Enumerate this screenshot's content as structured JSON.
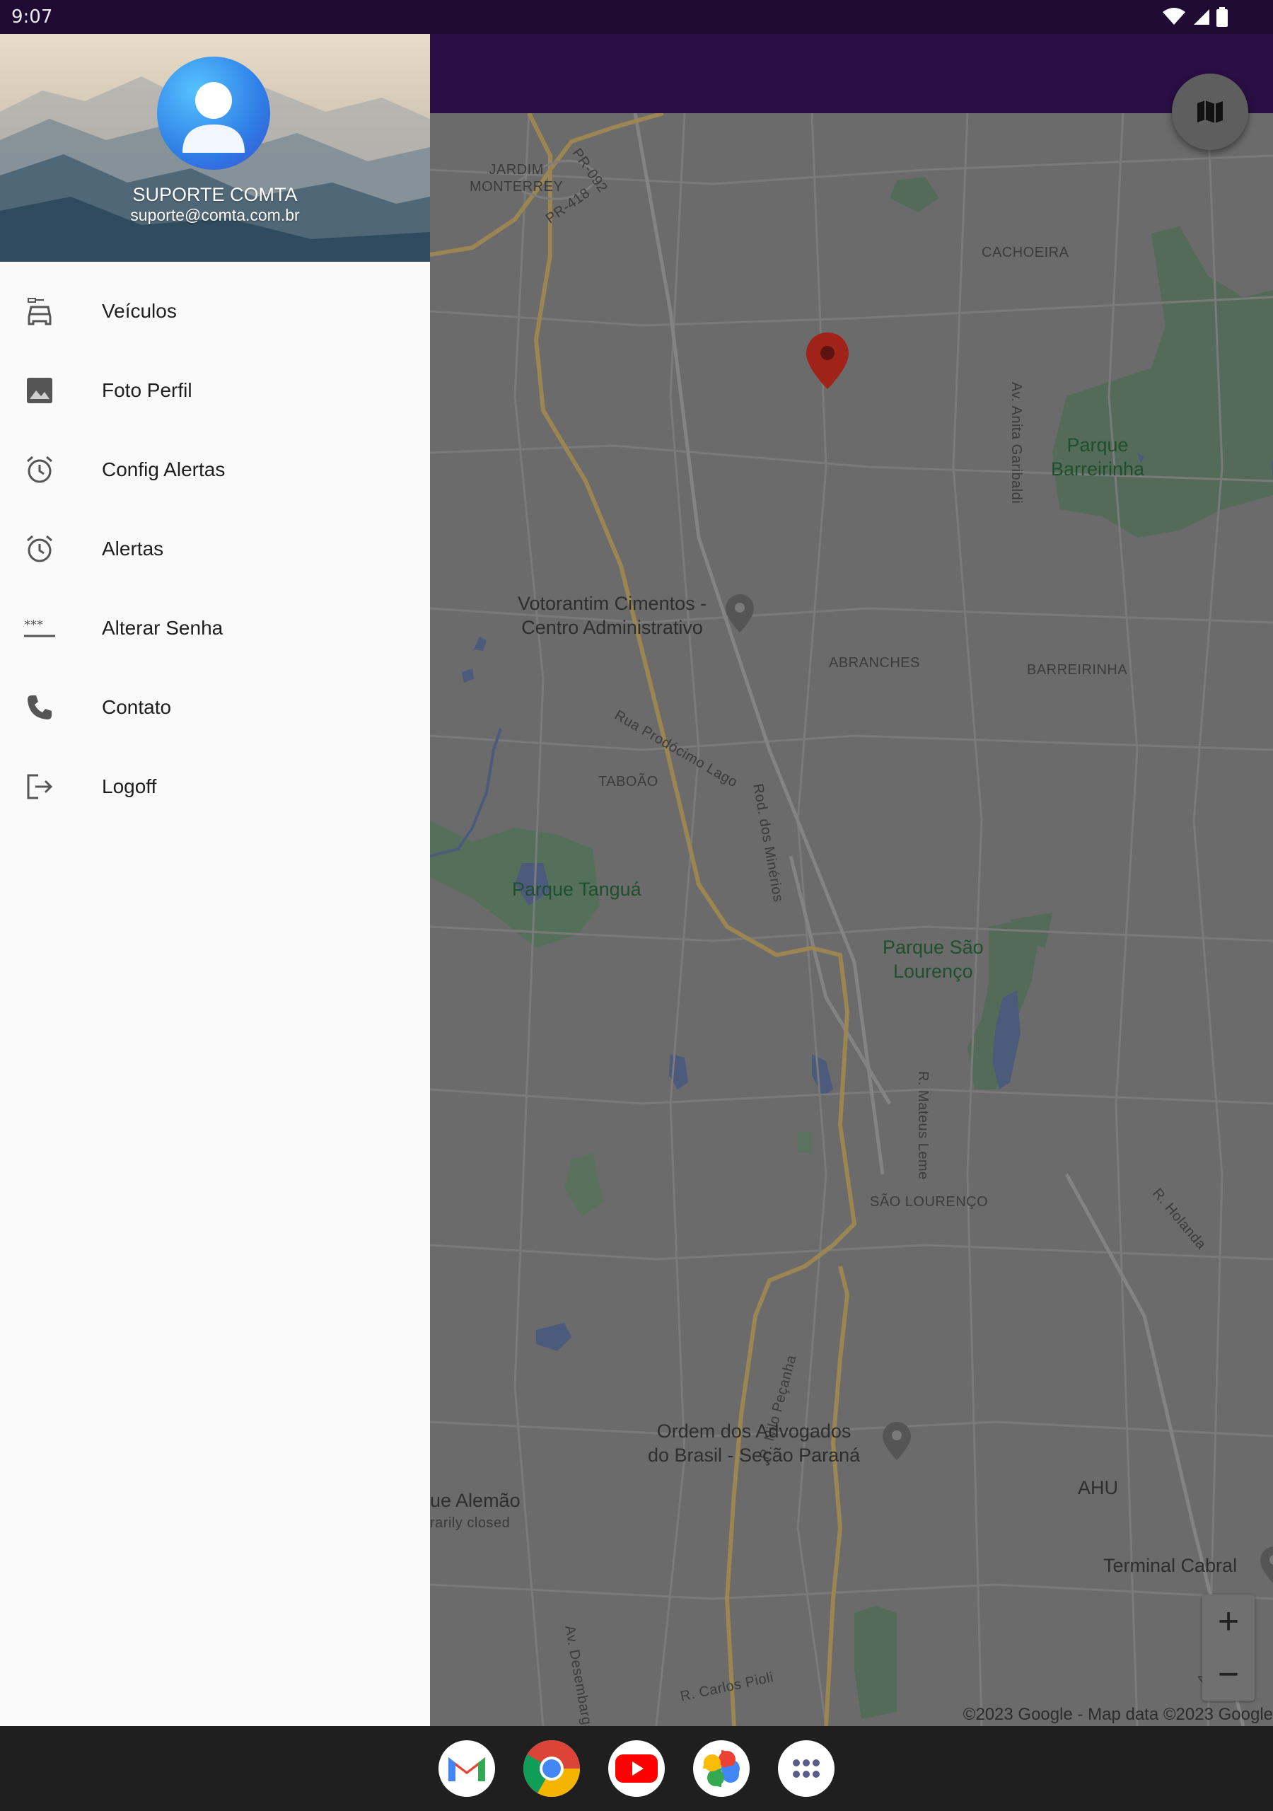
{
  "status_bar": {
    "time": "9:07"
  },
  "drawer": {
    "user": {
      "name": "SUPORTE COMTA",
      "email": "suporte@comta.com.br"
    },
    "items": [
      {
        "label": "Veículos",
        "icon": "car-icon"
      },
      {
        "label": "Foto Perfil",
        "icon": "image-icon"
      },
      {
        "label": "Config Alertas",
        "icon": "alarm-icon"
      },
      {
        "label": "Alertas",
        "icon": "alarm-icon"
      },
      {
        "label": "Alterar Senha",
        "icon": "password-icon"
      },
      {
        "label": "Contato",
        "icon": "phone-icon"
      },
      {
        "label": "Logoff",
        "icon": "logout-icon"
      }
    ]
  },
  "map": {
    "labels": {
      "jardim_monterrey": "JARDIM\nMONTERREY",
      "pr092": "PR-092",
      "pr418": "PR-418",
      "cachoeira": "CACHOEIRA",
      "anita": "Av. Anita Garibaldi",
      "parque_barreirinha": "Parque\nBarreirinha",
      "votorantim": "Votorantim Cimentos -\nCentro Administrativo",
      "abranches": "ABRANCHES",
      "barreirinha": "BARREIRINHA",
      "prodocimo": "Rua Prodócimo Lago",
      "taboao": "TABOÃO",
      "mineiros": "Rod. dos Minérios",
      "tangua": "Parque Tanguá",
      "sao_lourenco_park": "Parque São\nLourenço",
      "mateus": "R. Mateus Leme",
      "sao_lourenco": "SÃO LOURENÇO",
      "holanda": "R. Holanda",
      "nilo": "R. Nilo Peçanha",
      "oab": "Ordem dos Advogados\ndo Brasil - Seção Paraná",
      "alemao": "ue Alemão",
      "closed": "rarily closed",
      "ahu": "AHU",
      "cabral": "Terminal Cabral",
      "desembargador": "Av. Desembargador Hugo Simas",
      "carlos": "R. Carlos Pioli",
      "parana": "Av. Paraná"
    },
    "zoom_in": "+",
    "zoom_out": "−",
    "attribution": "©2023 Google - Map data ©2023 Google"
  },
  "dock": [
    "gmail-icon",
    "chrome-icon",
    "youtube-icon",
    "photos-icon",
    "app-drawer-icon"
  ]
}
